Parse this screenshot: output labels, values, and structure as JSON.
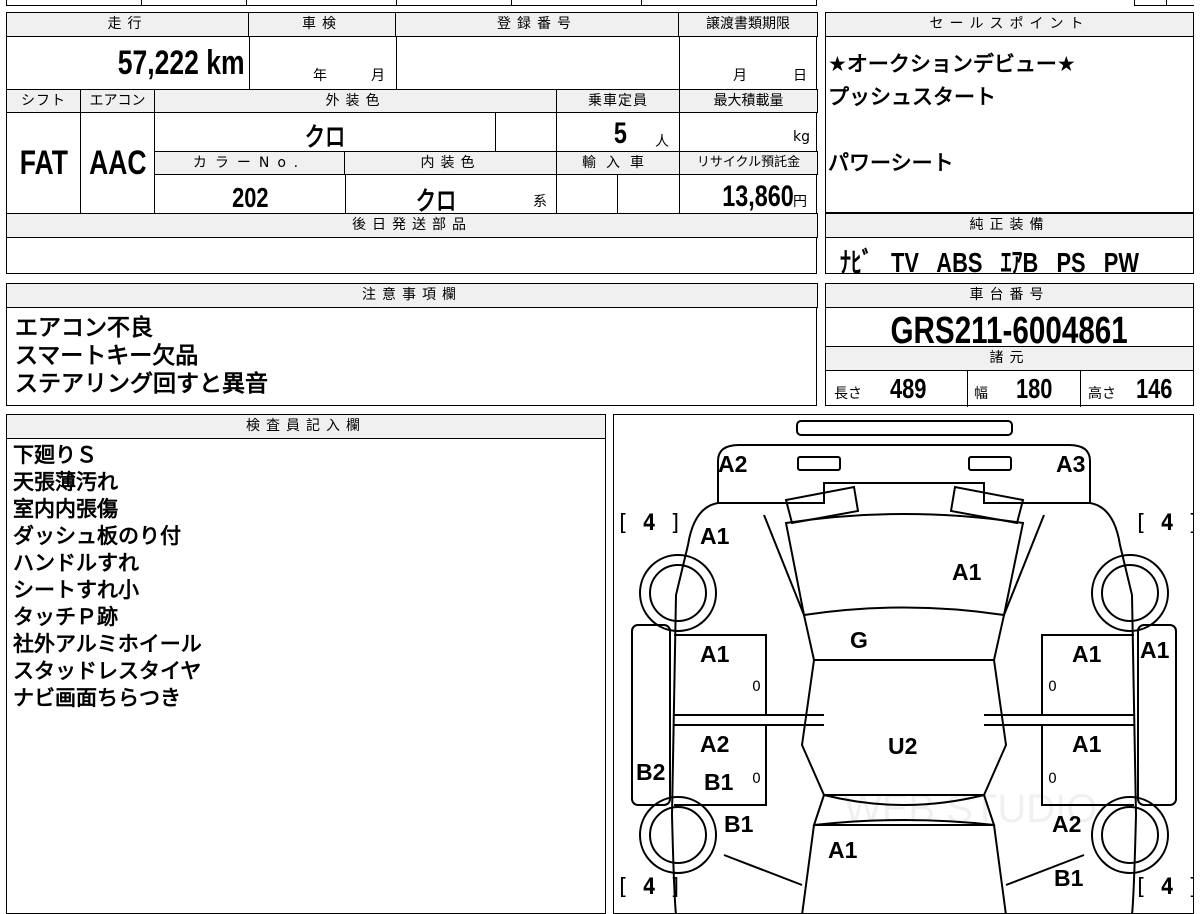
{
  "top_table": {
    "mileage_header": "走行",
    "mileage_value": "57,222",
    "mileage_unit": "km",
    "inspection_header": "車検",
    "inspection_year": "年",
    "inspection_month": "月",
    "registration_header": "登録番号",
    "transfer_header": "譲渡書類期限",
    "transfer_month": "月",
    "transfer_day": "日",
    "shift_header": "シフト",
    "shift_value": "FAT",
    "aircon_header": "エアコン",
    "aircon_value": "AAC",
    "exterior_color_header": "外装色",
    "exterior_color_value": "クロ",
    "capacity_header": "乗車定員",
    "capacity_value": "5",
    "capacity_unit": "人",
    "max_load_header": "最大積載量",
    "max_load_unit": "kg",
    "color_no_header": "カラーNo.",
    "color_no_value": "202",
    "interior_color_header": "内装色",
    "interior_color_value": "クロ",
    "interior_color_suffix": "系",
    "import_header": "輸入車",
    "recycle_header": "リサイクル預託金",
    "recycle_value": "13,860",
    "recycle_unit": "円",
    "later_parts_header": "後日発送部品"
  },
  "sales_points": {
    "header": "セールスポイント",
    "lines": [
      "★オークションデビュー★",
      "プッシュスタート",
      "",
      "パワーシート"
    ]
  },
  "genuine_equipment": {
    "header": "純正装備",
    "items": [
      "ﾅﾋﾞ",
      "TV",
      "ABS",
      "ｴｱB",
      "PS",
      "PW"
    ]
  },
  "notes": {
    "header": "注意事項欄",
    "lines": [
      "エアコン不良",
      "スマートキー欠品",
      "ステアリング回すと異音"
    ]
  },
  "chassis": {
    "header": "車台番号",
    "value": "GRS211-6004861"
  },
  "specs": {
    "header": "諸元",
    "length_label": "長さ",
    "length_value": "489",
    "width_label": "幅",
    "width_value": "180",
    "height_label": "高さ",
    "height_value": "146"
  },
  "inspector": {
    "header": "検査員記入欄",
    "lines": [
      "下廻りＳ",
      "天張薄汚れ",
      "室内内張傷",
      "ダッシュ板のり付",
      "ハンドルすれ",
      "シートすれ小",
      "タッチＰ跡",
      "社外アルミホイール",
      "スタッドレスタイヤ",
      "ナビ画面ちらつき"
    ]
  },
  "diagram": {
    "labels": {
      "front_left_corner": "A2",
      "front_right_corner": "A3",
      "hood_left": "A1",
      "hood_center": "A1",
      "windshield": "G",
      "front_left_door": "A1",
      "front_right_door": "A1",
      "right_fender": "A1",
      "rear_left_door_a": "A2",
      "rear_left_door_b": "B1",
      "rear_right_door": "A1",
      "roof": "U2",
      "left_side": "B2",
      "rear_left_quarter": "B1",
      "trunk": "A1",
      "rear_right_quarter": "A2",
      "rear_right_corner": "B1",
      "door_mark_fl": "0",
      "door_mark_fr": "0",
      "door_mark_rl": "0",
      "door_mark_rr": "0"
    },
    "tires": {
      "front_left": "4",
      "front_right": "4",
      "rear_left": "4",
      "rear_right": "4"
    },
    "watermark": "WEB STUDIO"
  }
}
